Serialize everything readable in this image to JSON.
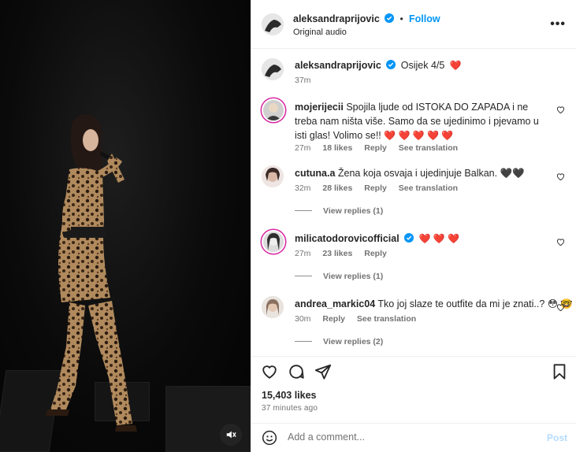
{
  "header": {
    "username": "aleksandraprijovic",
    "dot": "•",
    "follow_label": "Follow",
    "audio_label": "Original audio",
    "more_label": "•••"
  },
  "caption": {
    "username": "aleksandraprijovic",
    "text": "Osijek 4/5",
    "emoji": "❤️",
    "time": "37m"
  },
  "comments": [
    {
      "username": "mojerijecii",
      "text": "Spojila ljude od ISTOKA DO ZAPADA i ne treba nam ništa više. Samo da se ujedinimo i pjevamo u isti glas! Volimo se!!",
      "emoji": "❤️ ❤️ ❤️ ❤️ ❤️",
      "time": "27m",
      "likes": "18 likes",
      "reply": "Reply",
      "translate": "See translation"
    },
    {
      "username": "cutuna.a",
      "text": "Žena koja osvaja i ujedinjuje Balkan.",
      "emoji": "🖤🖤",
      "time": "32m",
      "likes": "28 likes",
      "reply": "Reply",
      "translate": "See translation",
      "view_replies": "View replies (1)"
    },
    {
      "username": "milicatodorovicofficial",
      "text": "",
      "emoji": "❤️ ❤️ ❤️",
      "time": "27m",
      "likes": "23 likes",
      "reply": "Reply",
      "view_replies": "View replies (1)"
    },
    {
      "username": "andrea_markic04",
      "text": "Tko joj slaze te outfite da mi je znati..?",
      "emoji": "😳 🤓",
      "time": "30m",
      "reply": "Reply",
      "translate": "See translation",
      "view_replies": "View replies (2)"
    }
  ],
  "stats": {
    "likes": "15,403 likes",
    "posted": "37 minutes ago"
  },
  "add_comment": {
    "placeholder": "Add a comment...",
    "post_label": "Post"
  },
  "colors": {
    "accent": "#0095f6",
    "verified": "#0095f6",
    "heart": "#ed1c24"
  }
}
